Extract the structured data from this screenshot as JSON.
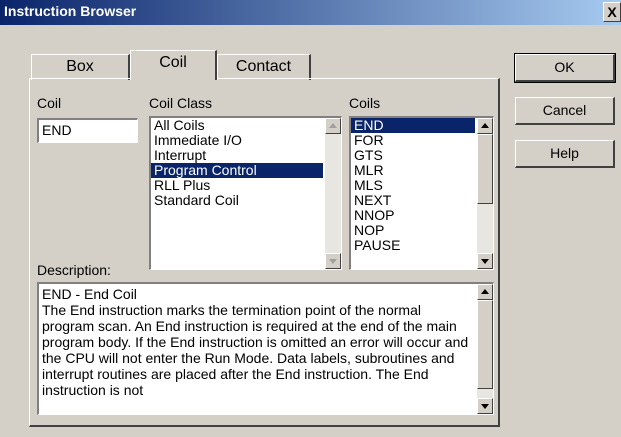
{
  "window": {
    "title": "Instruction Browser",
    "close_label": "X"
  },
  "tabs": [
    {
      "label": "Box"
    },
    {
      "label": "Coil",
      "active": true
    },
    {
      "label": "Contact"
    }
  ],
  "coil_field": {
    "label": "Coil",
    "value": "END"
  },
  "coil_class": {
    "label": "Coil Class",
    "items": [
      "All Coils",
      "Immediate I/O",
      "Interrupt",
      "Program Control",
      "RLL Plus",
      "Standard Coil"
    ],
    "selected": "Program Control"
  },
  "coils": {
    "label": "Coils",
    "items": [
      "END",
      "FOR",
      "GTS",
      "MLR",
      "MLS",
      "NEXT",
      "NNOP",
      "NOP",
      "PAUSE"
    ],
    "selected": "END"
  },
  "description": {
    "label": "Description:",
    "text": "END - End Coil\nThe End instruction marks the termination point of the normal program scan. An End instruction is required at the end of the main program body. If the End instruction is omitted an error will occur and the CPU will not enter the Run Mode. Data labels, subroutines and interrupt routines are placed after the End instruction. The End instruction is not"
  },
  "buttons": {
    "ok": "OK",
    "cancel": "Cancel",
    "help": "Help"
  },
  "colors": {
    "selection": "#0a246a",
    "face": "#d4d0c8"
  }
}
